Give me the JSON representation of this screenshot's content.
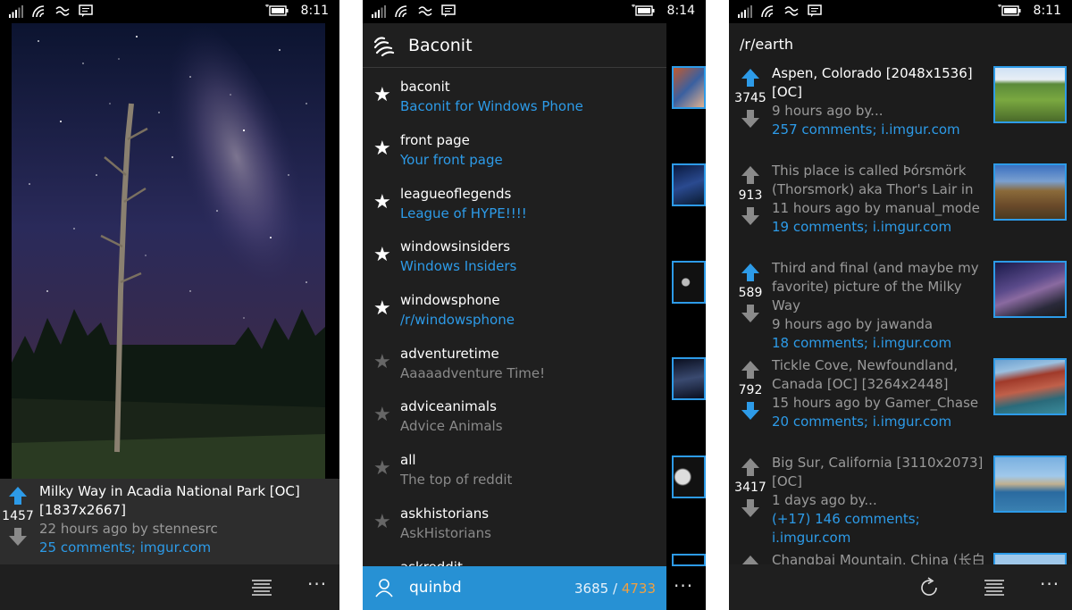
{
  "status": {
    "time_1": "8:11",
    "time_2": "8:14",
    "time_3": "8:11"
  },
  "detail": {
    "score": "1457",
    "title": "Milky Way in Acadia National Park [OC] [1837x2667]",
    "meta": "22 hours ago by stennesrc",
    "link": "25 comments; imgur.com"
  },
  "drawer": {
    "app_title": "Baconit",
    "items": [
      {
        "name": "baconit",
        "desc": "Baconit for Windows Phone",
        "starred": true
      },
      {
        "name": "front page",
        "desc": "Your front page",
        "starred": true
      },
      {
        "name": "leagueoflegends",
        "desc": "League of HYPE!!!!",
        "starred": true
      },
      {
        "name": "windowsinsiders",
        "desc": "Windows Insiders",
        "starred": true
      },
      {
        "name": "windowsphone",
        "desc": "/r/windowsphone",
        "starred": true
      },
      {
        "name": "adventuretime",
        "desc": "Aaaaadventure Time!",
        "starred": false
      },
      {
        "name": "adviceanimals",
        "desc": "Advice Animals",
        "starred": false
      },
      {
        "name": "all",
        "desc": "The top of reddit",
        "starred": false
      },
      {
        "name": "askhistorians",
        "desc": "AskHistorians",
        "starred": false
      },
      {
        "name": "askreddit",
        "desc": "",
        "starred": false
      }
    ],
    "user": {
      "name": "quinbd",
      "link_karma": "3685",
      "separator": "/",
      "comment_karma": "4733"
    }
  },
  "subreddit": {
    "path": "/r/earth",
    "posts": [
      {
        "score": "3745",
        "vote": "up",
        "title": "Aspen, Colorado [2048x1536] [OC]",
        "meta": "9 hours ago by...",
        "link": "257 comments; i.imgur.com",
        "extra": ""
      },
      {
        "score": "913",
        "vote": "none",
        "title": "This place is called Þórsmörk (Thorsmork) aka Thor's Lair in",
        "meta": "11 hours ago by manual_mode",
        "link": "19 comments; i.imgur.com",
        "extra": ""
      },
      {
        "score": "589",
        "vote": "up",
        "title": "Third and final (and maybe my favorite) picture of the Milky Way",
        "meta": "9 hours ago by jawanda",
        "link": "18 comments; i.imgur.com",
        "extra": ""
      },
      {
        "score": "792",
        "vote": "down",
        "title": "Tickle Cove, Newfoundland, Canada [OC] [3264x2448]",
        "meta": "15 hours ago by Gamer_Chase",
        "link": "20 comments; i.imgur.com",
        "extra": ""
      },
      {
        "score": "3417",
        "vote": "none",
        "title": "Big Sur, California [3110x2073] [OC]",
        "meta": "1 days ago by...",
        "link": "146 comments; i.imgur.com",
        "extra": "(+17) "
      },
      {
        "score": "",
        "vote": "none",
        "title": "Changbai Mountain, China (长白",
        "meta": "",
        "link": "",
        "extra": ""
      }
    ]
  },
  "colors": {
    "accent": "#2d9be8",
    "karma_orange": "#f0a040",
    "inactive": "#8a8a8a"
  },
  "icons": [
    "signal-icon",
    "wifi-icon",
    "data-sense-icon",
    "message-icon",
    "battery-icon",
    "upvote-icon",
    "downvote-icon",
    "star-icon",
    "baconit-logo-icon",
    "user-icon",
    "list-icon",
    "refresh-icon",
    "more-icon"
  ]
}
